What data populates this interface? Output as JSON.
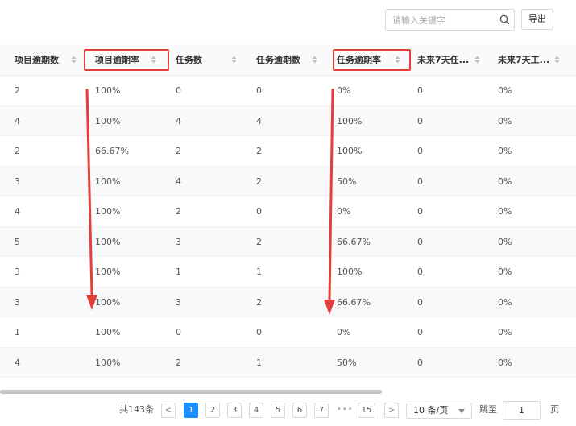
{
  "toolbar": {
    "search_placeholder": "请输入关键字",
    "search_icon": "search-icon",
    "export_label": "导出"
  },
  "columns": [
    {
      "label": "项目逾期数",
      "highlighted": false
    },
    {
      "label": "项目逾期率",
      "highlighted": true
    },
    {
      "label": "任务数",
      "highlighted": false
    },
    {
      "label": "任务逾期数",
      "highlighted": false
    },
    {
      "label": "任务逾期率",
      "highlighted": true
    },
    {
      "label": "未来7天任...",
      "highlighted": false
    },
    {
      "label": "未来7天工...",
      "highlighted": false
    }
  ],
  "rows": [
    [
      "2",
      "100%",
      "0",
      "0",
      "0%",
      "0",
      "0%"
    ],
    [
      "4",
      "100%",
      "4",
      "4",
      "100%",
      "0",
      "0%"
    ],
    [
      "2",
      "66.67%",
      "2",
      "2",
      "100%",
      "0",
      "0%"
    ],
    [
      "3",
      "100%",
      "4",
      "2",
      "50%",
      "0",
      "0%"
    ],
    [
      "4",
      "100%",
      "2",
      "0",
      "0%",
      "0",
      "0%"
    ],
    [
      "5",
      "100%",
      "3",
      "2",
      "66.67%",
      "0",
      "0%"
    ],
    [
      "3",
      "100%",
      "1",
      "1",
      "100%",
      "0",
      "0%"
    ],
    [
      "3",
      "100%",
      "3",
      "2",
      "66.67%",
      "0",
      "0%"
    ],
    [
      "1",
      "100%",
      "0",
      "0",
      "0%",
      "0",
      "0%"
    ],
    [
      "4",
      "100%",
      "2",
      "1",
      "50%",
      "0",
      "0%"
    ]
  ],
  "annotation": {
    "color": "#e3403b"
  },
  "pagination": {
    "total_text": "共143条",
    "prev_label": "<",
    "next_label": ">",
    "pages": [
      "1",
      "2",
      "3",
      "4",
      "5",
      "6",
      "7"
    ],
    "ellipsis": "•••",
    "last_page": "15",
    "current_page": "1",
    "page_size_label": "10 条/页",
    "jump_label": "跳至",
    "jump_value": "1",
    "page_unit": "页"
  },
  "colors": {
    "accent": "#1890ff",
    "stripe": "#f8f9fb",
    "header_bg": "#fafafa"
  }
}
